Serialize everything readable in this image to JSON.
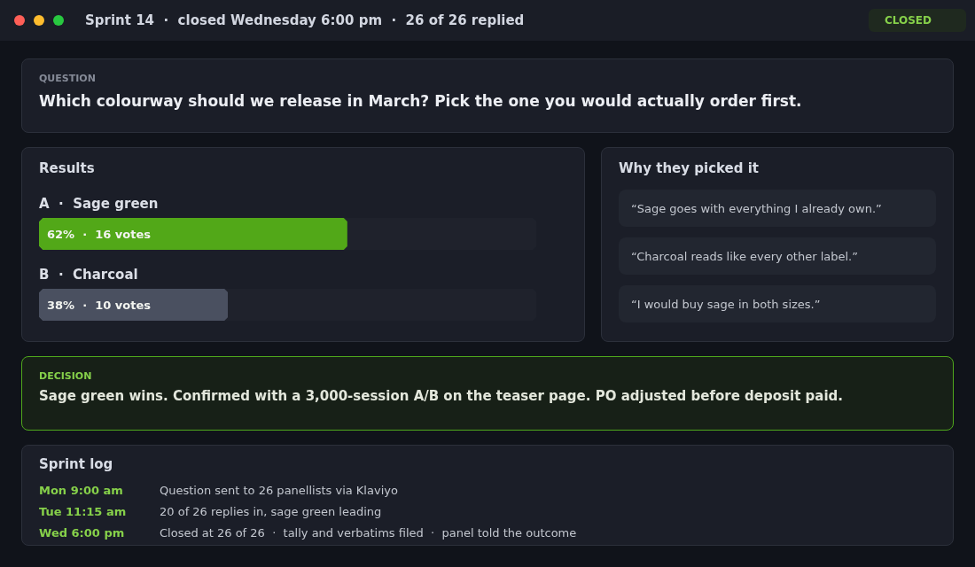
{
  "window": {
    "controls": [
      {
        "color": "#ff5f57"
      },
      {
        "color": "#febc2e"
      },
      {
        "color": "#28c840"
      }
    ],
    "title": "Sprint 14  ·  closed Wednesday 6:00 pm  ·  26 of 26 replied",
    "status_badge": "CLOSED"
  },
  "question": {
    "label": "QUESTION",
    "text": "Which colourway should we release in March? Pick the one you would actually order first."
  },
  "results": {
    "title": "Results",
    "options": [
      {
        "label": "A  ·  Sage green",
        "summary": "62%  ·  16 votes",
        "level": 0.62,
        "color": "#52a818"
      },
      {
        "label": "B  ·  Charcoal",
        "summary": "38%  ·  10 votes",
        "level": 0.38,
        "color": "#4a5060"
      }
    ]
  },
  "reasons": {
    "title": "Why they picked it",
    "quotes": [
      "“Sage goes with everything I already own.”",
      "“Charcoal reads like every other label.”",
      "“I would buy sage in both sizes.”"
    ]
  },
  "decision": {
    "label": "DECISION",
    "text": "Sage green wins. Confirmed with a 3,000-session A/B on the teaser page. PO adjusted before deposit paid."
  },
  "log": {
    "title": "Sprint log",
    "entries": [
      {
        "time": "Mon 9:00 am",
        "text": "Question sent to 26 panellists via Klaviyo"
      },
      {
        "time": "Tue 11:15 am",
        "text": "20 of 26 replies in, sage green leading"
      },
      {
        "time": "Wed 6:00 pm",
        "text": "Closed at 26 of 26  ·  tally and verbatims filed  ·  panel told the outcome"
      }
    ]
  }
}
